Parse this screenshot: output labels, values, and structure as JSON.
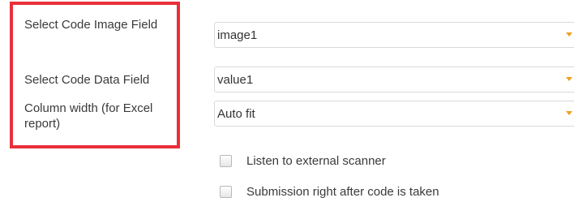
{
  "labels": {
    "code_image_field": "Select Code Image Field",
    "code_data_field": "Select Code Data Field",
    "column_width": "Column width (for Excel report)"
  },
  "selects": {
    "code_image_field_value": "image1",
    "code_data_field_value": "value1",
    "column_width_value": "Auto fit"
  },
  "checkboxes": {
    "listen_external_scanner": "Listen to external scanner",
    "submission_after_code": "Submission right after code is taken"
  },
  "colors": {
    "highlight_border": "#e8303a",
    "dropdown_arrow": "#f0a020"
  },
  "icons": {
    "dropdown": "chevron-down-icon"
  }
}
